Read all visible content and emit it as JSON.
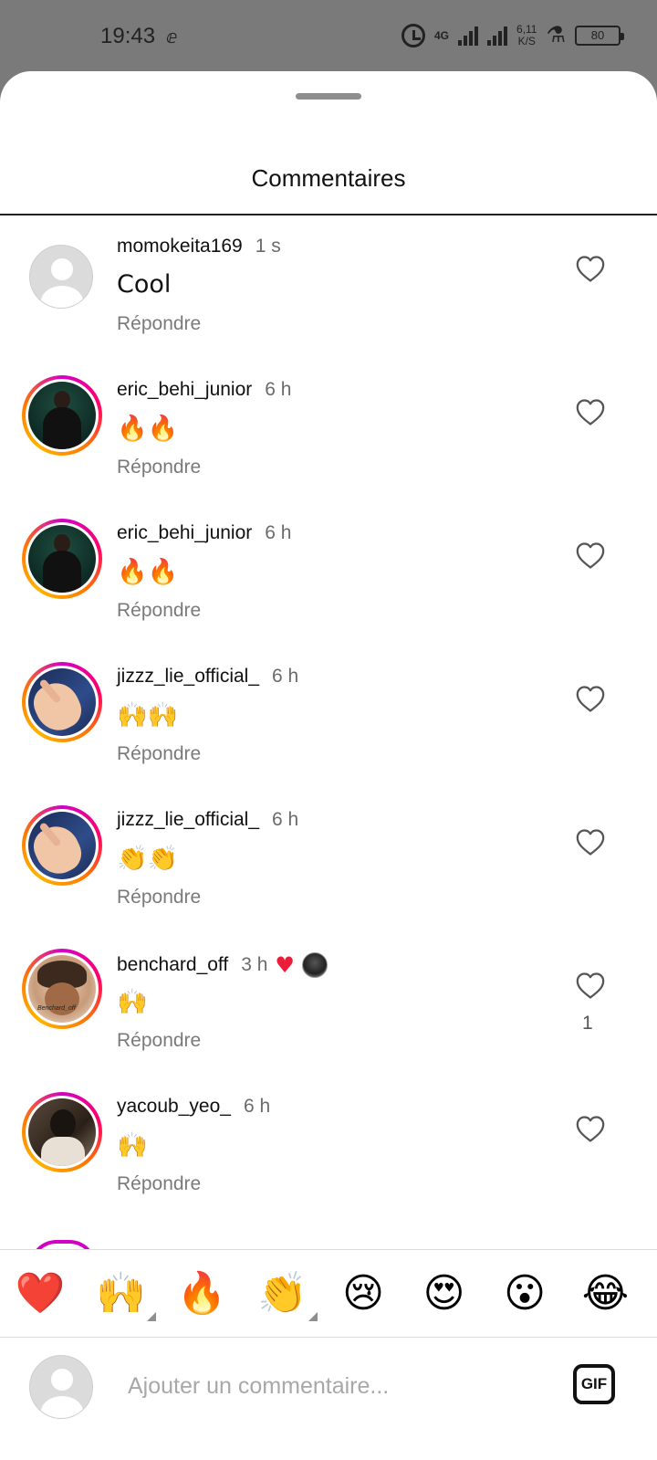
{
  "status_bar": {
    "time": "19:43",
    "carrier_glyph": "ⅇ",
    "network": "4G",
    "speed_top": "6,11",
    "speed_bottom": "K/S",
    "battery": "80"
  },
  "sheet": {
    "title": "Commentaires"
  },
  "comments": [
    {
      "user": "momokeita169",
      "time": "1 s",
      "text": "Cool",
      "reply": "Répondre",
      "avatar": "default",
      "likes": ""
    },
    {
      "user": "eric_behi_junior",
      "time": "6 h",
      "text": "🔥🔥",
      "reply": "Répondre",
      "avatar": "green",
      "likes": ""
    },
    {
      "user": "eric_behi_junior",
      "time": "6 h",
      "text": "🔥🔥",
      "reply": "Répondre",
      "avatar": "green",
      "likes": ""
    },
    {
      "user": "jizzz_lie_official_",
      "time": "6 h",
      "text": "🙌🙌",
      "reply": "Répondre",
      "avatar": "hand",
      "likes": ""
    },
    {
      "user": "jizzz_lie_official_",
      "time": "6 h",
      "text": "👏👏",
      "reply": "Répondre",
      "avatar": "hand",
      "likes": ""
    },
    {
      "user": "benchard_off",
      "time": "3 h",
      "text": "🙌",
      "reply": "Répondre",
      "avatar": "cartoon",
      "avatar_caption": "Benchard_off",
      "liked_by_creator": true,
      "likes": "1"
    },
    {
      "user": "yacoub_yeo_",
      "time": "6 h",
      "text": "🙌",
      "reply": "Répondre",
      "avatar": "selfie",
      "likes": ""
    }
  ],
  "reactions": [
    {
      "emoji": "❤️",
      "has_variants": false
    },
    {
      "emoji": "🙌",
      "has_variants": true
    },
    {
      "emoji": "🔥",
      "has_variants": false
    },
    {
      "emoji": "👏",
      "has_variants": true
    },
    {
      "emoji": "😢",
      "has_variants": false
    },
    {
      "emoji": "😍",
      "has_variants": false
    },
    {
      "emoji": "😮",
      "has_variants": false
    },
    {
      "emoji": "😂",
      "has_variants": false
    }
  ],
  "composer": {
    "placeholder": "Ajouter un commentaire...",
    "gif_label": "GIF"
  },
  "colors": {
    "like_red": "#ed1d3a",
    "muted_text": "#7a7a7a",
    "story_ring_start": "#d300c5",
    "story_ring_end": "#ff7a00"
  }
}
